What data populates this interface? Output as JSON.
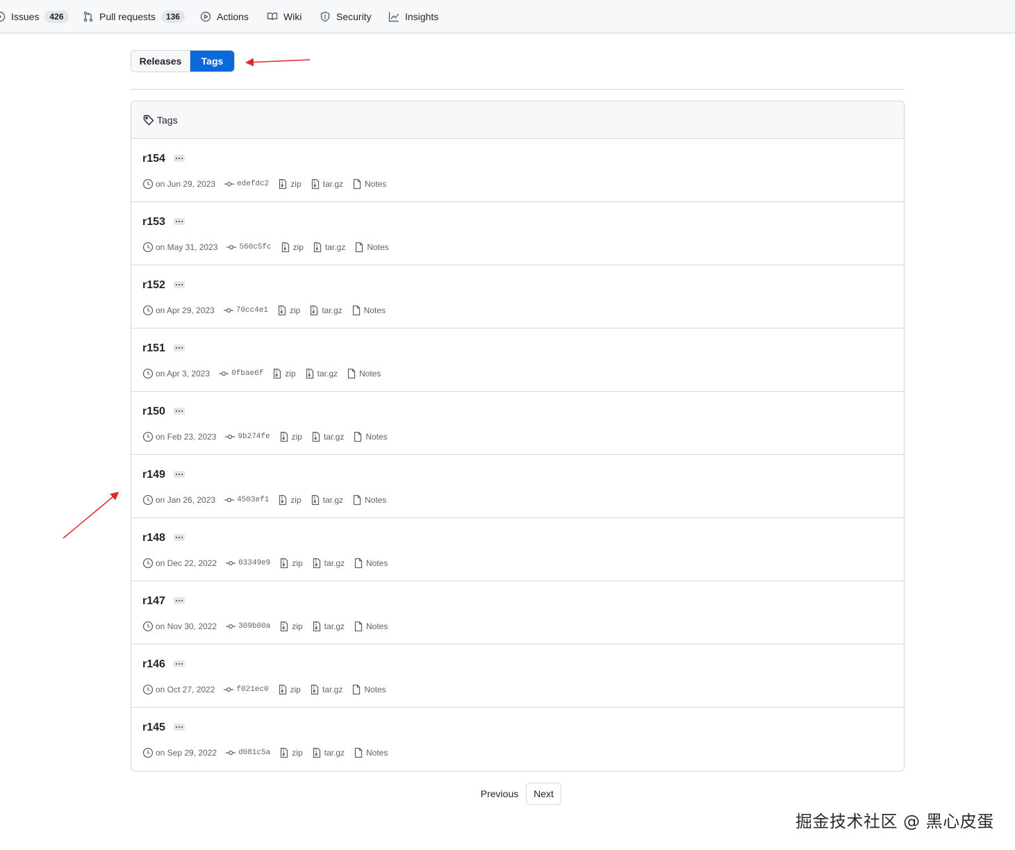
{
  "nav": {
    "issues": {
      "label": "Issues",
      "count": "426"
    },
    "pulls": {
      "label": "Pull requests",
      "count": "136"
    },
    "actions": {
      "label": "Actions"
    },
    "wiki": {
      "label": "Wiki"
    },
    "security": {
      "label": "Security"
    },
    "insights": {
      "label": "Insights"
    }
  },
  "segmented": {
    "releases": "Releases",
    "tags": "Tags"
  },
  "box_title": "Tags",
  "tags": [
    {
      "name": "r154",
      "date": "on Jun 29, 2023",
      "sha": "edefdc2",
      "zip": "zip",
      "targz": "tar.gz",
      "notes": "Notes"
    },
    {
      "name": "r153",
      "date": "on May 31, 2023",
      "sha": "560c5fc",
      "zip": "zip",
      "targz": "tar.gz",
      "notes": "Notes"
    },
    {
      "name": "r152",
      "date": "on Apr 29, 2023",
      "sha": "70cc4e1",
      "zip": "zip",
      "targz": "tar.gz",
      "notes": "Notes"
    },
    {
      "name": "r151",
      "date": "on Apr 3, 2023",
      "sha": "0fbae6f",
      "zip": "zip",
      "targz": "tar.gz",
      "notes": "Notes"
    },
    {
      "name": "r150",
      "date": "on Feb 23, 2023",
      "sha": "9b274fe",
      "zip": "zip",
      "targz": "tar.gz",
      "notes": "Notes"
    },
    {
      "name": "r149",
      "date": "on Jan 26, 2023",
      "sha": "4503ef1",
      "zip": "zip",
      "targz": "tar.gz",
      "notes": "Notes"
    },
    {
      "name": "r148",
      "date": "on Dec 22, 2022",
      "sha": "03349e9",
      "zip": "zip",
      "targz": "tar.gz",
      "notes": "Notes"
    },
    {
      "name": "r147",
      "date": "on Nov 30, 2022",
      "sha": "309b00a",
      "zip": "zip",
      "targz": "tar.gz",
      "notes": "Notes"
    },
    {
      "name": "r146",
      "date": "on Oct 27, 2022",
      "sha": "f021ec0",
      "zip": "zip",
      "targz": "tar.gz",
      "notes": "Notes"
    },
    {
      "name": "r145",
      "date": "on Sep 29, 2022",
      "sha": "d081c5a",
      "zip": "zip",
      "targz": "tar.gz",
      "notes": "Notes"
    }
  ],
  "pagination": {
    "previous": "Previous",
    "next": "Next"
  },
  "watermark": "掘金技术社区 @ 黑心皮蛋",
  "colors": {
    "accent": "#0969da",
    "annotation": "#e0262b"
  }
}
